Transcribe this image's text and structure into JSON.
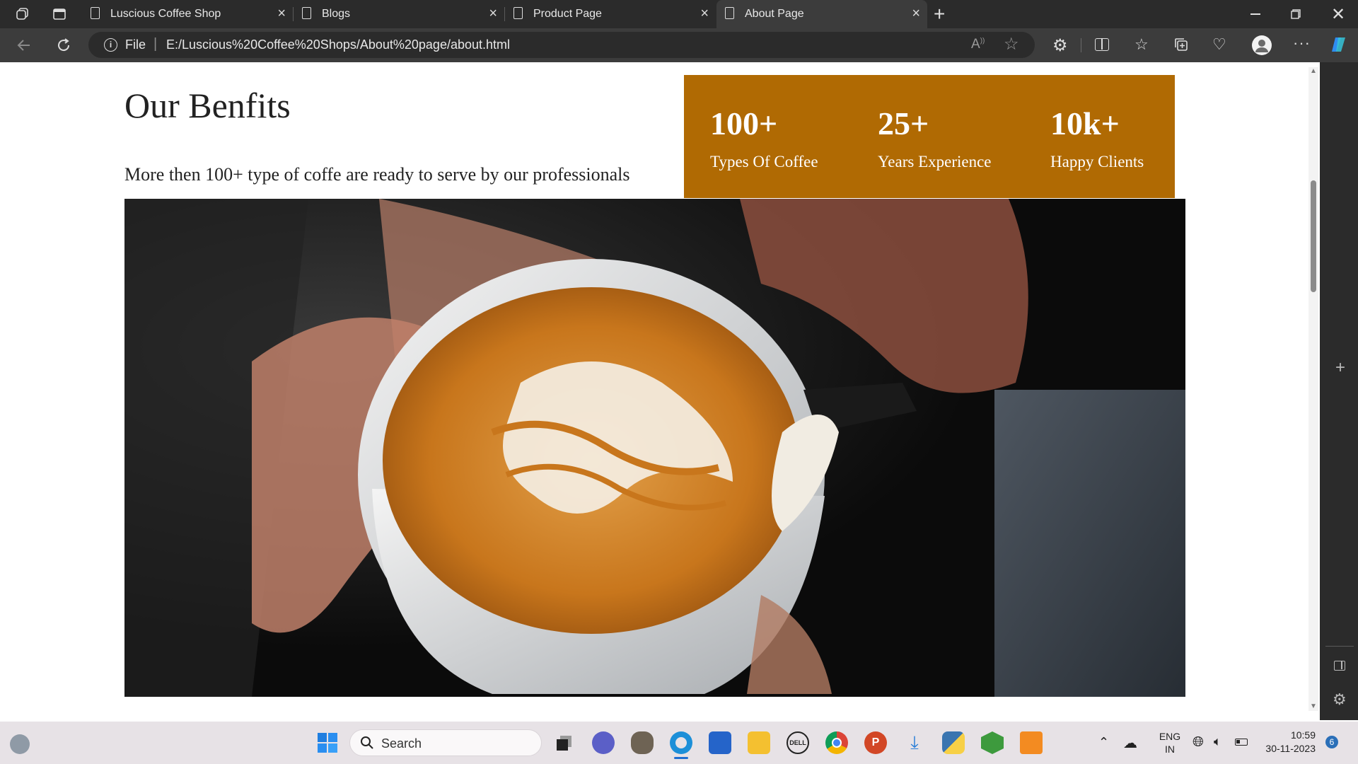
{
  "browser": {
    "tabs": [
      {
        "label": "Luscious Coffee Shop",
        "active": false
      },
      {
        "label": "Blogs",
        "active": false
      },
      {
        "label": "Product Page",
        "active": false
      },
      {
        "label": "About Page",
        "active": true
      }
    ],
    "address": {
      "protocol_label": "File",
      "url": "E:/Luscious%20Coffee%20Shops/About%20page/about.html"
    },
    "accent": "#2b2b2b"
  },
  "page": {
    "heading": "Our Benfits",
    "subtext": "More then 100+ type of coffe are ready to serve by our professionals",
    "stats_bg": "#b06a03",
    "stats": [
      {
        "value": "100+",
        "label": "Types Of Coffee"
      },
      {
        "value": "25+",
        "label": "Years Experience"
      },
      {
        "value": "10k+",
        "label": "Happy Clients"
      }
    ]
  },
  "taskbar": {
    "search_label": "Search",
    "lang_top": "ENG",
    "lang_bottom": "IN",
    "time": "10:59",
    "date": "30-11-2023",
    "notification_count": "6"
  }
}
